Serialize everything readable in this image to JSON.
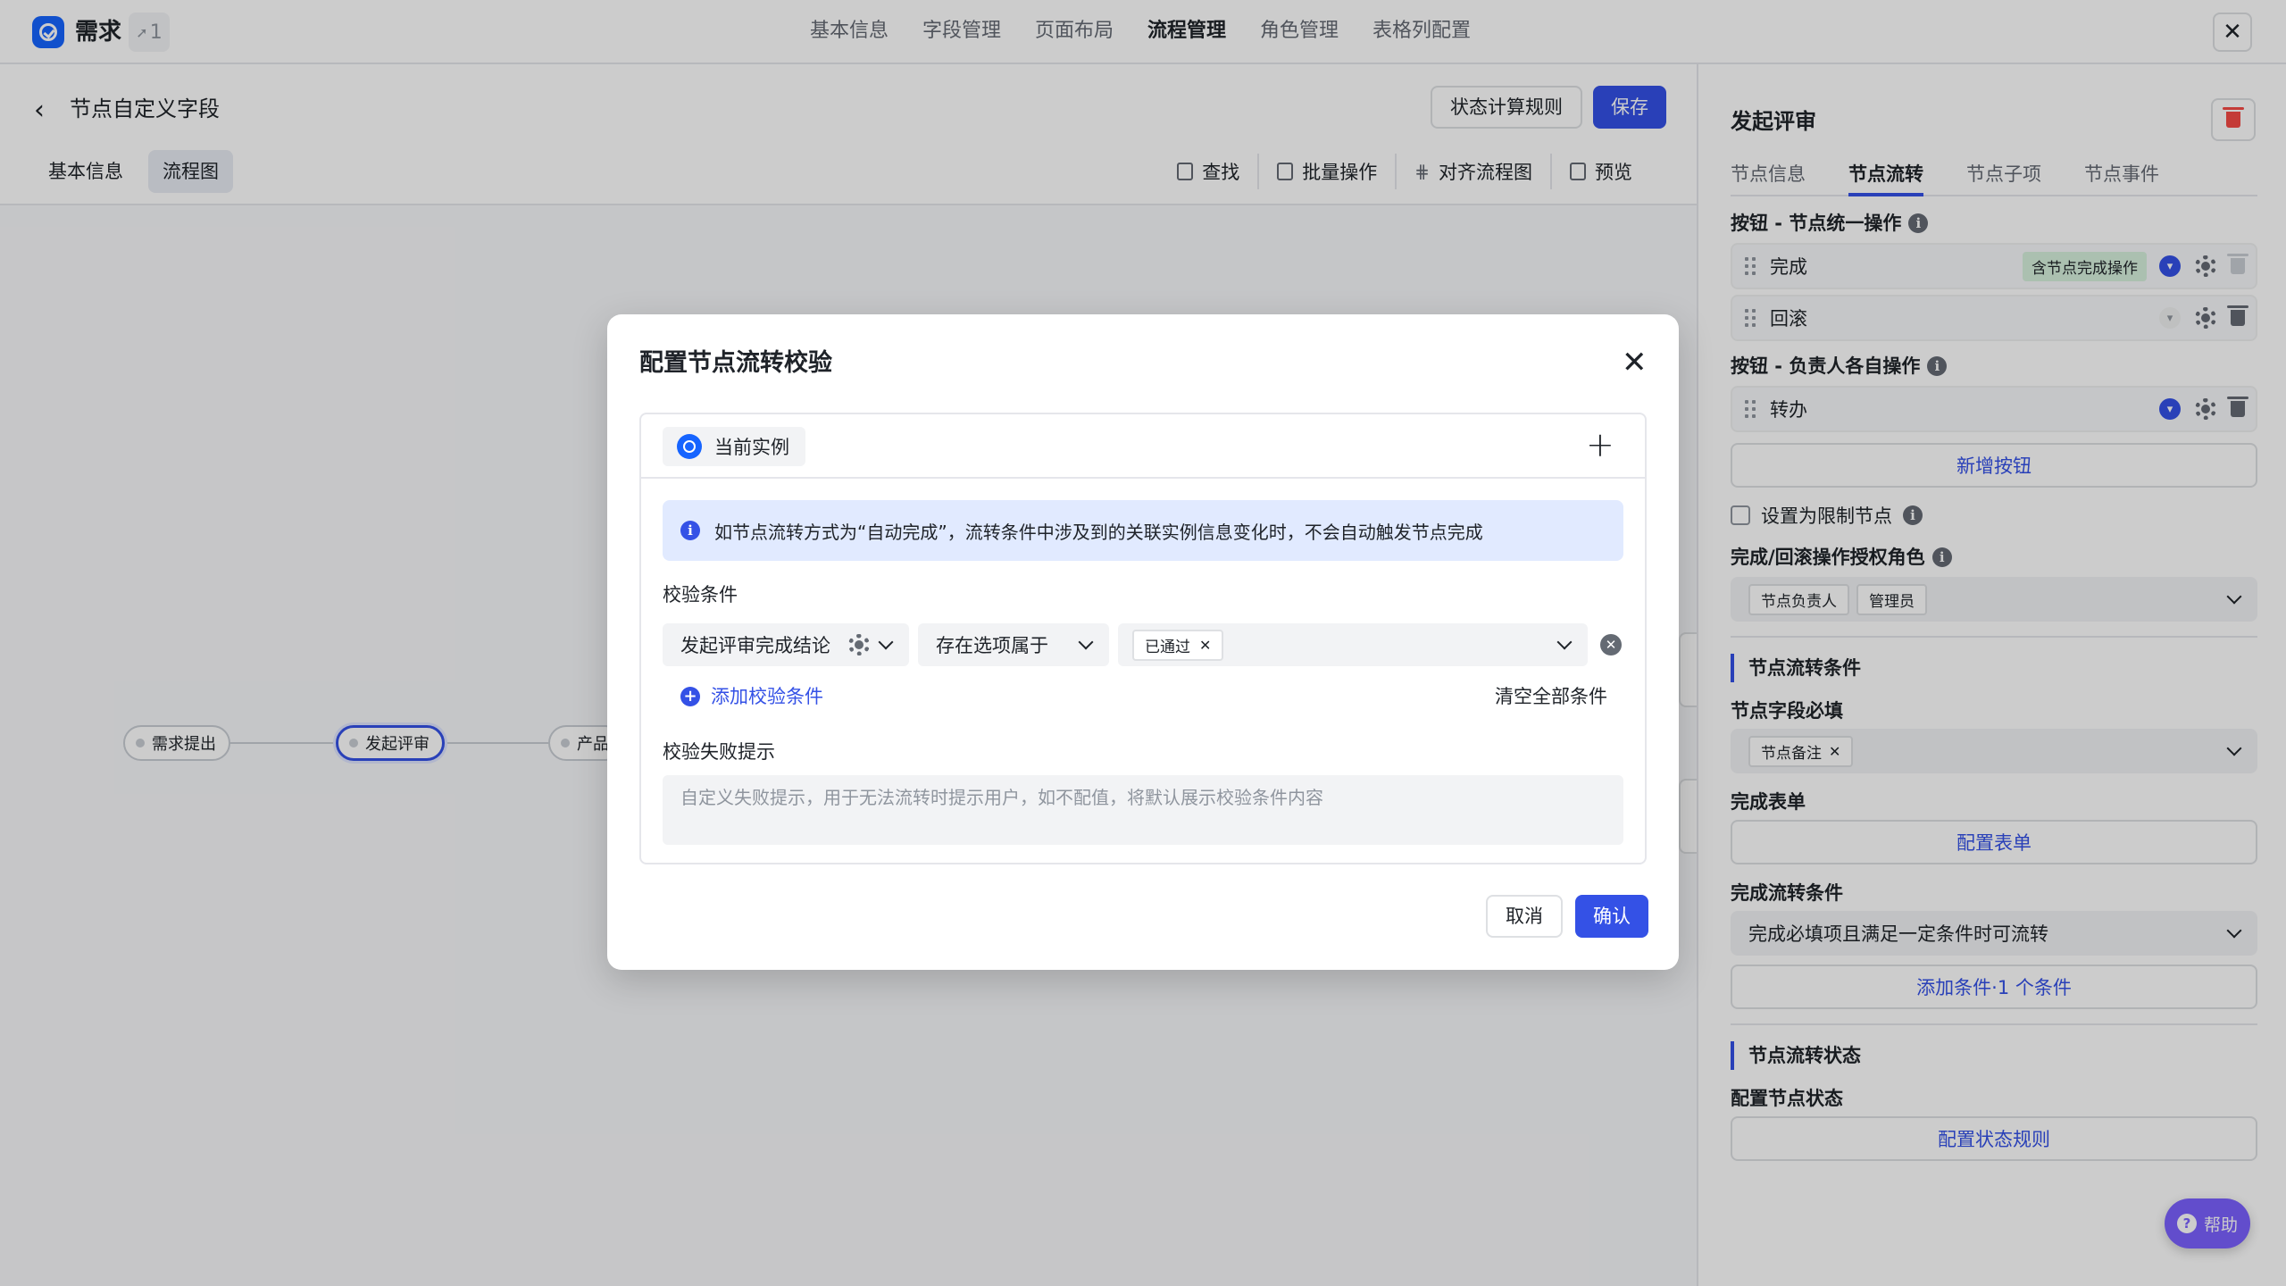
{
  "app": {
    "title": "需求",
    "link_count": "1",
    "link_icon": "arrow-link-icon"
  },
  "nav": {
    "tabs": [
      "基本信息",
      "字段管理",
      "页面布局",
      "流程管理",
      "角色管理",
      "表格列配置"
    ],
    "active": "流程管理"
  },
  "editor": {
    "page_title": "节点自定义字段",
    "rule_button": "状态计算规则",
    "save_button": "保存",
    "sub_tabs": [
      "基本信息",
      "流程图"
    ],
    "active_sub_tab": "流程图",
    "toolbar": [
      "查找",
      "批量操作",
      "对齐流程图",
      "预览"
    ],
    "flow_nodes": [
      "需求提出",
      "发起评审",
      "产品"
    ],
    "selected_node": "发起评审"
  },
  "panel": {
    "title": "发起评审",
    "tabs": [
      "节点信息",
      "节点流转",
      "节点子项",
      "节点事件"
    ],
    "active_tab": "节点流转",
    "unified_label": "按钮 - 节点统一操作",
    "unified_ops": [
      {
        "label": "完成",
        "tag": "含节点完成操作"
      },
      {
        "label": "回滚",
        "tag": ""
      }
    ],
    "own_label": "按钮 - 负责人各自操作",
    "own_ops": [
      {
        "label": "转办"
      }
    ],
    "add_button": "新增按钮",
    "restrict_label": "设置为限制节点",
    "roles_label": "完成/回滚操作授权角色",
    "roles": [
      "节点负责人",
      "管理员"
    ],
    "flow_cond_title": "节点流转条件",
    "required_label": "节点字段必填",
    "required_fields": [
      "节点备注"
    ],
    "form_label": "完成表单",
    "form_button": "配置表单",
    "complete_cond_label": "完成流转条件",
    "complete_cond_value": "完成必填项且满足一定条件时可流转",
    "add_cond_button": "添加条件·1 个条件",
    "status_title": "节点流转状态",
    "status_label": "配置节点状态",
    "status_button": "配置状态规则"
  },
  "help": {
    "label": "帮助"
  },
  "modal": {
    "title": "配置节点流转校验",
    "instance_chip": "当前实例",
    "notice": "如节点流转方式为“自动完成”，流转条件中涉及到的关联实例信息变化时，不会自动触发节点完成",
    "conditions_label": "校验条件",
    "condition": {
      "field": "发起评审完成结论",
      "operator": "存在选项属于",
      "values": [
        "已通过"
      ]
    },
    "add_condition": "添加校验条件",
    "clear_all": "清空全部条件",
    "fail_label": "校验失败提示",
    "fail_placeholder": "自定义失败提示，用于无法流转时提示用户，如不配值，将默认展示校验条件内容",
    "cancel": "取消",
    "confirm": "确认"
  },
  "colors": {
    "primary": "#3451e6",
    "brand": "#1664ff",
    "danger": "#f54a45",
    "help": "#7b61ff",
    "tag_green": "#d6f0dc"
  }
}
